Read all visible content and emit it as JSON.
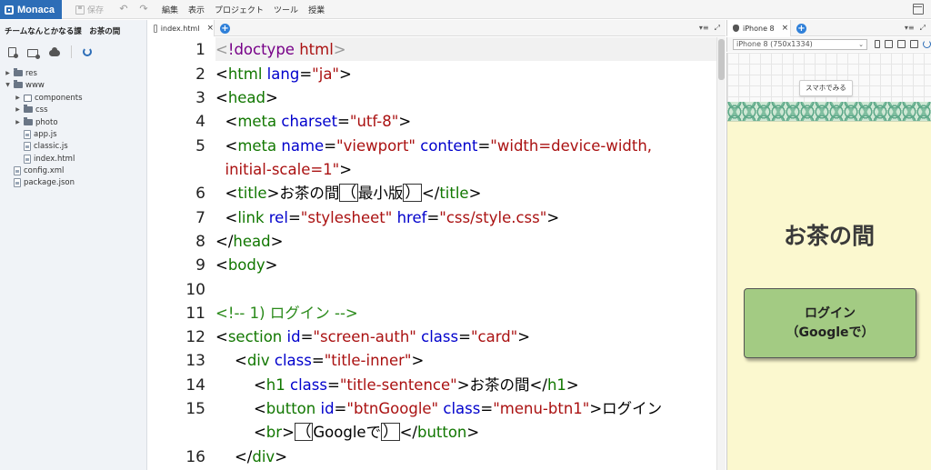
{
  "topbar": {
    "logo": "Monaca",
    "save_label": "保存",
    "menu": [
      "編集",
      "表示",
      "プロジェクト",
      "ツール",
      "授業"
    ]
  },
  "sidebar": {
    "project_title": "チームなんとかなる課　お茶の間",
    "tree": [
      {
        "label": "res",
        "type": "folder",
        "depth": 0,
        "expanded": false
      },
      {
        "label": "www",
        "type": "folder",
        "depth": 0,
        "expanded": true
      },
      {
        "label": "components",
        "type": "component-folder",
        "depth": 1,
        "expanded": false
      },
      {
        "label": "css",
        "type": "folder",
        "depth": 1,
        "expanded": false
      },
      {
        "label": "photo",
        "type": "folder",
        "depth": 1,
        "expanded": false
      },
      {
        "label": "app.js",
        "type": "file",
        "depth": 1
      },
      {
        "label": "classic.js",
        "type": "file",
        "depth": 1
      },
      {
        "label": "index.html",
        "type": "file",
        "depth": 1
      },
      {
        "label": "config.xml",
        "type": "file",
        "depth": 0
      },
      {
        "label": "package.json",
        "type": "file",
        "depth": 0
      }
    ]
  },
  "editor": {
    "tab_label": "index.html",
    "line_numbers": [
      "1",
      "2",
      "3",
      "4",
      "5",
      "",
      "6",
      "7",
      "8",
      "9",
      "10",
      "11",
      "12",
      "13",
      "14",
      "15",
      "",
      "16"
    ]
  },
  "preview": {
    "tab_label": "iPhone 8",
    "device_select": "iPhone 8 (750x1334)",
    "smartphone_button": "スマホでみる",
    "app_title": "お茶の間",
    "login_line1": "ログイン",
    "login_line2": "（Googleで）"
  },
  "colors": {
    "brand": "#2c6db7",
    "preview_bg": "#fbf8cf",
    "login_button": "#a3cb83",
    "pattern": "#5fa98a"
  }
}
